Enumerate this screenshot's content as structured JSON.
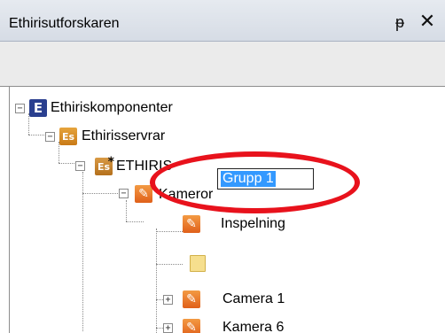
{
  "panel": {
    "title": "Ethirisutforskaren",
    "pin_glyph": "ᵽ",
    "close_glyph": "✕"
  },
  "tree": {
    "nodes": [
      {
        "label": "Ethiriskomponenter",
        "icon": "ethiris-e-icon",
        "expander": "−"
      },
      {
        "label": "Ethirisservrar",
        "icon": "server-group-icon",
        "expander": "−"
      },
      {
        "label": "ETHIRIS",
        "icon": "server-icon",
        "expander": "−",
        "icon_text": "Es",
        "badge": "*"
      },
      {
        "label": "Kameror",
        "icon": "camera-group-icon",
        "expander": "−"
      },
      {
        "label": "Inspelning",
        "icon": "camera-icon"
      },
      {
        "label": "Grupp 1",
        "icon": "folder-icon",
        "editing": true
      },
      {
        "label": "Camera 1",
        "icon": "camera-icon",
        "expander": "+"
      },
      {
        "label": "Kamera 6",
        "icon": "camera-icon",
        "expander": "+"
      }
    ],
    "e_icon_text": "E",
    "es_icon_text": "Es"
  },
  "colors": {
    "highlight_ellipse": "#e8121c",
    "selection": "#3399ff",
    "icon_blue": "#2a3f8f",
    "icon_orange": "#e0601a"
  }
}
